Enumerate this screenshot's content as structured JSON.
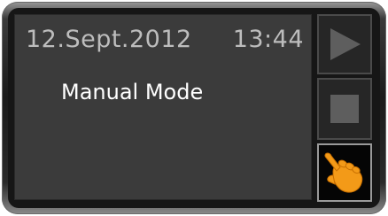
{
  "display": {
    "date": "12.Sept.2012",
    "time": "13:44",
    "mode": "Manual Mode"
  },
  "buttons": {
    "play": {
      "icon": "play-icon"
    },
    "stop": {
      "icon": "stop-icon"
    },
    "manual": {
      "icon": "hand-pointer-icon",
      "active": true
    }
  },
  "colors": {
    "screen_background": "#3b3b3b",
    "status_text": "#bdbdbd",
    "mode_text": "#ffffff",
    "inactive_icon": "#5e5e5e",
    "active_icon": "#f39a18"
  }
}
